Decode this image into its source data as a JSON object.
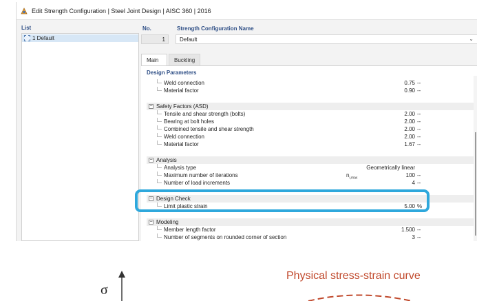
{
  "window": {
    "title": "Edit Strength Configuration | Steel Joint Design | AISC 360 | 2016"
  },
  "list": {
    "header": "List",
    "items": [
      {
        "label": "1  Default"
      }
    ]
  },
  "config": {
    "no_label": "No.",
    "no_value": "1",
    "name_label": "Strength Configuration Name",
    "name_value": "Default",
    "name_chevron": "⌄"
  },
  "tabs": [
    {
      "label": "Main",
      "active": true
    },
    {
      "label": "Buckling",
      "active": false
    }
  ],
  "design_parameters": {
    "header": "Design Parameters",
    "top_rows": [
      {
        "label": "Weld connection",
        "value": "0.75",
        "unit": "--"
      },
      {
        "label": "Material factor",
        "value": "0.90",
        "unit": "--"
      }
    ],
    "groups": [
      {
        "name": "Safety Factors (ASD)",
        "rows": [
          {
            "label": "Tensile and shear strength (bolts)",
            "value": "2.00",
            "unit": "--"
          },
          {
            "label": "Bearing at bolt holes",
            "value": "2.00",
            "unit": "--"
          },
          {
            "label": "Combined tensile and shear strength",
            "value": "2.00",
            "unit": "--"
          },
          {
            "label": "Weld connection",
            "value": "2.00",
            "unit": "--"
          },
          {
            "label": "Material factor",
            "value": "1.67",
            "unit": "--"
          }
        ]
      },
      {
        "name": "Analysis",
        "rows": [
          {
            "label": "Analysis type",
            "value": "Geometrically linear",
            "unit": ""
          },
          {
            "label": "Maximum number of iterations",
            "symbol": "n",
            "symbol_sub": "i,max",
            "value": "100",
            "unit": "--"
          },
          {
            "label": "Number of load increments",
            "value": "4",
            "unit": "--"
          }
        ]
      },
      {
        "name": "Design Check",
        "rows": [
          {
            "label": "Limit plastic strain",
            "value": "5.00",
            "unit": "%"
          }
        ]
      },
      {
        "name": "Modeling",
        "rows": [
          {
            "label": "Member length factor",
            "value": "1.500",
            "unit": "--"
          },
          {
            "label": "Number of segments on rounded corner of section",
            "value": "3",
            "unit": "--"
          }
        ]
      }
    ],
    "toggle_symbol": "−"
  },
  "figure": {
    "axis_symbol": "σ",
    "curve_title": "Physical stress-strain curve"
  },
  "colors": {
    "highlight": "#2fa8dc",
    "section_header": "#2f4f86",
    "curve_title": "#c0482b",
    "list_selection": "#d7e7f6"
  }
}
